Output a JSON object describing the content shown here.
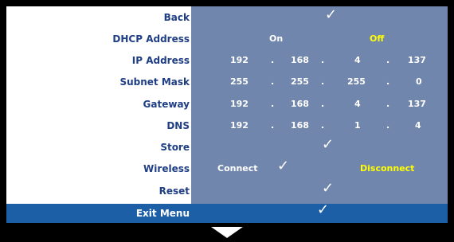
{
  "menu": {
    "back": {
      "label": "Back",
      "check": "✓"
    },
    "dhcp": {
      "label": "DHCP Address",
      "on": "On",
      "off": "Off"
    },
    "ip": {
      "label": "IP Address",
      "o1": "192",
      "o2": "168",
      "o3": "4",
      "o4": "137"
    },
    "subnet": {
      "label": "Subnet Mask",
      "o1": "255",
      "o2": "255",
      "o3": "255",
      "o4": "0"
    },
    "gateway": {
      "label": "Gateway",
      "o1": "192",
      "o2": "168",
      "o3": "4",
      "o4": "137"
    },
    "dns": {
      "label": "DNS",
      "o1": "192",
      "o2": "168",
      "o3": "1",
      "o4": "4"
    },
    "store": {
      "label": "Store",
      "check": "✓"
    },
    "wireless": {
      "label": "Wireless",
      "connect": "Connect",
      "check": "✓",
      "disconnect": "Disconnect"
    },
    "reset": {
      "label": "Reset",
      "check": "✓"
    },
    "exit": {
      "label": "Exit Menu",
      "check": "✓"
    },
    "dot": "."
  },
  "colors": {
    "label": "#1f3e84",
    "panel": "#7186ad",
    "highlight": "#1d5fa6",
    "off": "#ffff00"
  },
  "icons": {
    "check": "check-icon",
    "arrow": "down-arrow-icon"
  }
}
